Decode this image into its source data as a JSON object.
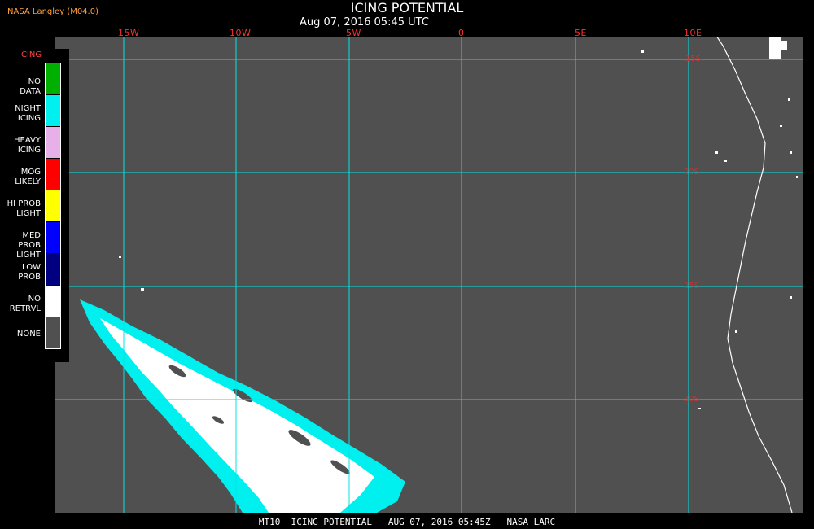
{
  "header": {
    "title": "ICING POTENTIAL",
    "time": "Aug 07, 2016 05:45 UTC",
    "producer": "NASA Langley (M04.0)"
  },
  "map": {
    "lon_labels": [
      "15W",
      "10W",
      "5W",
      "0",
      "5E",
      "10E"
    ],
    "lat_labels": [
      "15S",
      "20S",
      "25S",
      "30S"
    ],
    "grid_color": "#00e5e5",
    "background_color": "#505050",
    "coastline_color": "#ffffff"
  },
  "legend": {
    "title": "ICING",
    "items": [
      {
        "label": "NO DATA",
        "color": "#00b000"
      },
      {
        "label": "NIGHT ICING",
        "color": "#00f0f0"
      },
      {
        "label": "HEAVY ICING",
        "color": "#e8b0e8"
      },
      {
        "label": "MOG LIKELY",
        "color": "#ff0000"
      },
      {
        "label": "HI PROB LIGHT",
        "color": "#ffff00"
      },
      {
        "label": "MED PROB LIGHT",
        "color": "#0000ff"
      },
      {
        "label": "LOW PROB",
        "color": "#000080"
      },
      {
        "label": "NO RETRVL",
        "color": "#ffffff"
      },
      {
        "label": "NONE",
        "color": "#505050"
      }
    ]
  },
  "footer": {
    "text": "MT10  ICING POTENTIAL   AUG 07, 2016 05:45Z   NASA LARC"
  }
}
